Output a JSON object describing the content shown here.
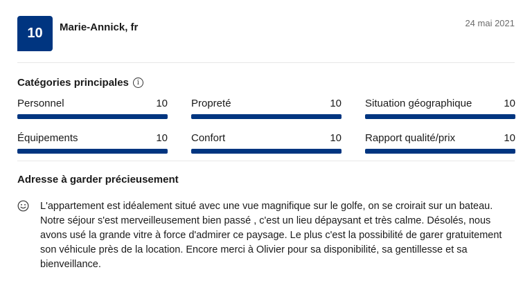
{
  "review": {
    "score": "10",
    "reviewer": "Marie-Annick, fr",
    "date": "24 mai 2021"
  },
  "categories": {
    "title": "Catégories principales",
    "info_icon": "info-icon",
    "items": [
      {
        "label": "Personnel",
        "score": "10",
        "fill": 1.0
      },
      {
        "label": "Propreté",
        "score": "10",
        "fill": 1.0
      },
      {
        "label": "Situation géographique",
        "score": "10",
        "fill": 1.0
      },
      {
        "label": "Équipements",
        "score": "10",
        "fill": 1.0
      },
      {
        "label": "Confort",
        "score": "10",
        "fill": 1.0
      },
      {
        "label": "Rapport qualité/prix",
        "score": "10",
        "fill": 1.0
      }
    ]
  },
  "comment": {
    "title": "Adresse à garder précieusement",
    "icon": "smile-icon",
    "text": "L'appartement est idéalement situé avec une vue magnifique sur le golfe, on se croirait sur un bateau. Notre séjour s'est merveilleusement bien passé , c'est un lieu dépaysant et très calme. Désolés, nous avons usé la grande vitre à force d'admirer ce paysage. Le plus c'est la possibilité de garer gratuitement son véhicule près de la location. Encore merci à Olivier pour sa disponibilité, sa gentillesse et sa bienveillance."
  },
  "colors": {
    "brand": "#003580",
    "muted_text": "#6b6b6b",
    "divider": "#e7e7e7"
  }
}
